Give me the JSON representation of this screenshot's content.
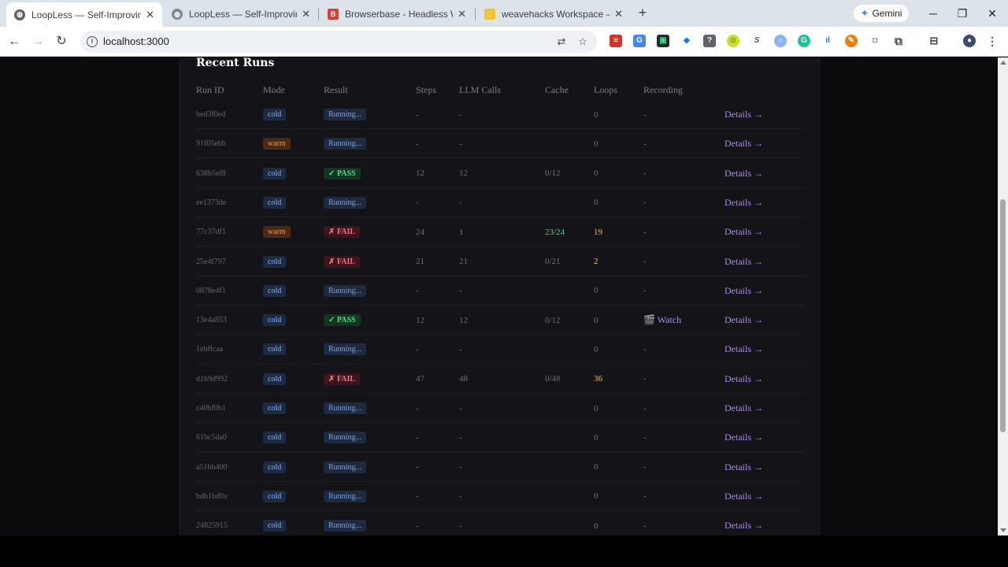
{
  "browser": {
    "tabs": [
      {
        "title": "LoopLess — Self-Improving Bro",
        "favicon": "globe-icon",
        "active": true
      },
      {
        "title": "LoopLess — Self-Improving Bro",
        "favicon": "globe-icon",
        "active": false
      },
      {
        "title": "Browserbase - Headless Web Br",
        "favicon": "browserbase-icon",
        "active": false
      },
      {
        "title": "weavehacks Workspace – Weig",
        "favicon": "wandb-icon",
        "active": false
      }
    ],
    "new_tab": "+",
    "gemini_label": "Gemini",
    "url": "localhost:3000"
  },
  "table": {
    "title": "Recent Runs",
    "columns": [
      "Run ID",
      "Mode",
      "Result",
      "Steps",
      "LLM Calls",
      "Cache",
      "Loops",
      "Recording",
      ""
    ],
    "rows": [
      {
        "id": "bed3f0ed",
        "mode": "cold",
        "result": "Running...",
        "steps": "-",
        "llm": "-",
        "cache": "",
        "loops": "0",
        "recording": "-",
        "details": "Details →"
      },
      {
        "id": "91f05ebb",
        "mode": "warm",
        "result": "Running...",
        "steps": "-",
        "llm": "-",
        "cache": "",
        "loops": "0",
        "recording": "-",
        "details": "Details →"
      },
      {
        "id": "638b5ef8",
        "mode": "cold",
        "result": "✓ PASS",
        "steps": "12",
        "llm": "12",
        "cache": "0/12",
        "loops": "0",
        "recording": "-",
        "details": "Details →"
      },
      {
        "id": "ee1373de",
        "mode": "cold",
        "result": "Running...",
        "steps": "-",
        "llm": "-",
        "cache": "",
        "loops": "0",
        "recording": "-",
        "details": "Details →"
      },
      {
        "id": "77c37df1",
        "mode": "warm",
        "result": "✗ FAIL",
        "steps": "24",
        "llm": "1",
        "cache": "23/24",
        "loops": "19",
        "recording": "-",
        "details": "Details →"
      },
      {
        "id": "25e4f797",
        "mode": "cold",
        "result": "✗ FAIL",
        "steps": "21",
        "llm": "21",
        "cache": "0/21",
        "loops": "2",
        "recording": "-",
        "details": "Details →"
      },
      {
        "id": "0878e4f1",
        "mode": "cold",
        "result": "Running...",
        "steps": "-",
        "llm": "-",
        "cache": "",
        "loops": "0",
        "recording": "-",
        "details": "Details →"
      },
      {
        "id": "13e4a853",
        "mode": "cold",
        "result": "✓ PASS",
        "steps": "12",
        "llm": "12",
        "cache": "0/12",
        "loops": "0",
        "recording": "🎬 Watch",
        "details": "Details →"
      },
      {
        "id": "1ebffcaa",
        "mode": "cold",
        "result": "Running...",
        "steps": "-",
        "llm": "-",
        "cache": "",
        "loops": "0",
        "recording": "-",
        "details": "Details →"
      },
      {
        "id": "d1b9d992",
        "mode": "cold",
        "result": "✗ FAIL",
        "steps": "47",
        "llm": "48",
        "cache": "0/48",
        "loops": "36",
        "recording": "-",
        "details": "Details →"
      },
      {
        "id": "c40bf0b1",
        "mode": "cold",
        "result": "Running...",
        "steps": "-",
        "llm": "-",
        "cache": "",
        "loops": "0",
        "recording": "-",
        "details": "Details →"
      },
      {
        "id": "61bc5da0",
        "mode": "cold",
        "result": "Running...",
        "steps": "-",
        "llm": "-",
        "cache": "",
        "loops": "0",
        "recording": "-",
        "details": "Details →"
      },
      {
        "id": "a51bb400",
        "mode": "cold",
        "result": "Running...",
        "steps": "-",
        "llm": "-",
        "cache": "",
        "loops": "0",
        "recording": "-",
        "details": "Details →"
      },
      {
        "id": "bdb1bd0a",
        "mode": "cold",
        "result": "Running...",
        "steps": "-",
        "llm": "-",
        "cache": "",
        "loops": "0",
        "recording": "-",
        "details": "Details →"
      },
      {
        "id": "24825915",
        "mode": "cold",
        "result": "Running...",
        "steps": "-",
        "llm": "-",
        "cache": "",
        "loops": "0",
        "recording": "-",
        "details": "Details →"
      }
    ]
  },
  "colors": {
    "page_bg": "#0b0b0d",
    "panel_bg": "#141418",
    "accent_link": "#a98cf0",
    "pass": "#58d68d",
    "fail": "#f07386",
    "warm": "#e89a5a",
    "cold": "#8fb2ee",
    "loops_highlight": "#e8c547",
    "cache_highlight": "#4cd07d"
  }
}
